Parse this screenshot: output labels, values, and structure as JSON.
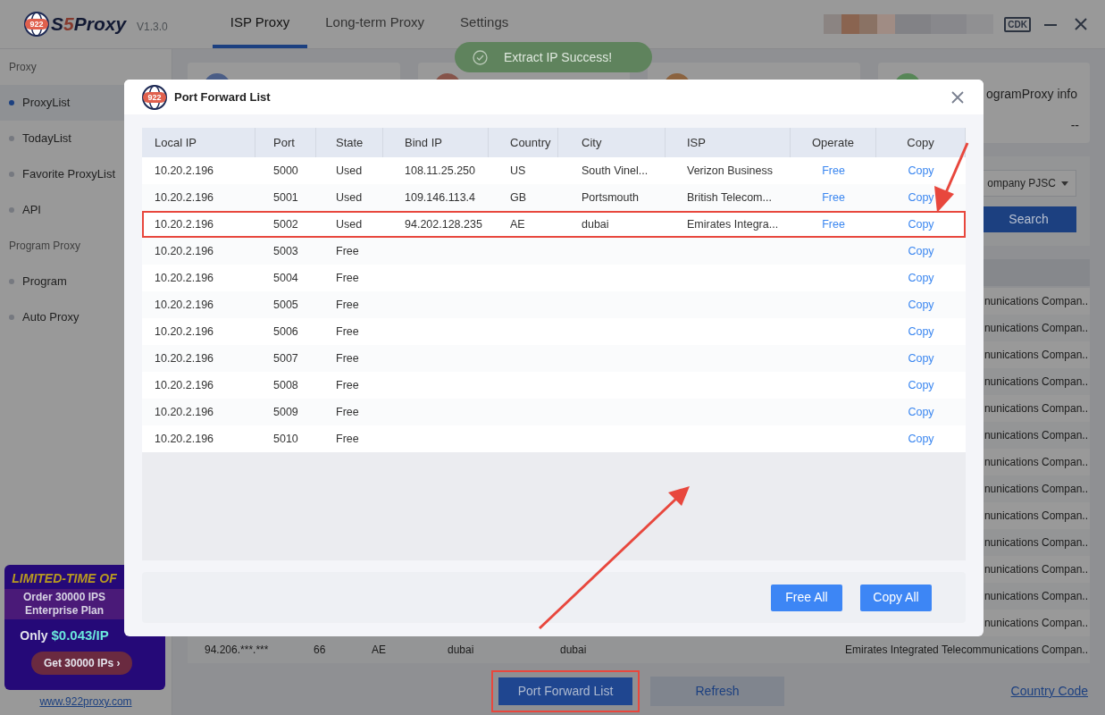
{
  "header": {
    "logo_badge": "922",
    "brand_prefix": "S",
    "brand_accent": "5",
    "brand_suffix": "Proxy",
    "version": "V1.3.0",
    "tabs": [
      {
        "label": "ISP Proxy",
        "selected": true
      },
      {
        "label": "Long-term Proxy",
        "selected": false
      },
      {
        "label": "Settings",
        "selected": false
      }
    ],
    "cdk_button": "CDK"
  },
  "toast": {
    "message": "Extract IP Success!"
  },
  "sidebar": {
    "sections": [
      {
        "title": "Proxy",
        "items": [
          {
            "label": "ProxyList",
            "selected": true
          },
          {
            "label": "TodayList",
            "selected": false
          },
          {
            "label": "Favorite ProxyList",
            "selected": false
          },
          {
            "label": "API",
            "selected": false
          }
        ]
      },
      {
        "title": "Program Proxy",
        "items": [
          {
            "label": "Program",
            "selected": false
          },
          {
            "label": "Auto Proxy",
            "selected": false
          }
        ]
      }
    ],
    "banner": {
      "headline": "LIMITED-TIME OF",
      "line_1": "Order 30000 IPS",
      "line_2": "Enterprise Plan",
      "only": "Only",
      "price": "$0.043/IP",
      "cta": "Get 30000 IPs ›"
    },
    "link": "www.922proxy.com"
  },
  "stat_cards": [
    {
      "color": "#4a5d86"
    },
    {
      "color": "#86544a"
    },
    {
      "color": "#8b633f"
    },
    {
      "color": "#568656",
      "title": "ogramProxy info",
      "value": "--"
    }
  ],
  "filter": {
    "select_value": "ompany PJSC",
    "search_button": "Search"
  },
  "proxy_rows": [
    {
      "isp": "nunications Compan.."
    },
    {
      "isp": "nunications Compan.."
    },
    {
      "isp": "nunications Compan.."
    },
    {
      "isp": "nunications Compan.."
    },
    {
      "isp": "nunications Compan.."
    },
    {
      "isp": "nunications Compan.."
    },
    {
      "isp": "nunications Compan.."
    },
    {
      "isp": "nunications Compan.."
    },
    {
      "isp": "nunications Compan.."
    },
    {
      "isp": "nunications Compan.."
    },
    {
      "isp": "nunications Compan.."
    },
    {
      "isp": "nunications Compan.."
    },
    {
      "isp": "nunications Compan.."
    },
    {
      "ip": "94.206.***.***",
      "port": "66",
      "country": "AE",
      "region": "dubai",
      "city": "dubai",
      "isp": "Emirates Integrated Telecommunications Compan.."
    }
  ],
  "bottom_bar": {
    "port_forward_button": "Port Forward List",
    "port_forward_annotated": true,
    "refresh_button": "Refresh",
    "country_code_link": "Country Code"
  },
  "modal": {
    "logo_badge": "922",
    "title": "Port Forward List",
    "columns": [
      "Local IP",
      "Port",
      "State",
      "Bind IP",
      "Country",
      "City",
      "ISP",
      "Operate",
      "Copy"
    ],
    "rows": [
      {
        "local_ip": "10.20.2.196",
        "port": "5000",
        "state": "Used",
        "bind_ip": "108.11.25.250",
        "country": "US",
        "city": "South Vinel...",
        "isp": "Verizon Business",
        "operate": "Free",
        "copy": "Copy",
        "highlighted": false
      },
      {
        "local_ip": "10.20.2.196",
        "port": "5001",
        "state": "Used",
        "bind_ip": "109.146.113.4",
        "country": "GB",
        "city": "Portsmouth",
        "isp": "British Telecom...",
        "operate": "Free",
        "copy": "Copy",
        "highlighted": false
      },
      {
        "local_ip": "10.20.2.196",
        "port": "5002",
        "state": "Used",
        "bind_ip": "94.202.128.235",
        "country": "AE",
        "city": "dubai",
        "isp": "Emirates Integra...",
        "operate": "Free",
        "copy": "Copy",
        "highlighted": true
      },
      {
        "local_ip": "10.20.2.196",
        "port": "5003",
        "state": "Free",
        "copy": "Copy",
        "highlighted": false
      },
      {
        "local_ip": "10.20.2.196",
        "port": "5004",
        "state": "Free",
        "copy": "Copy",
        "highlighted": false
      },
      {
        "local_ip": "10.20.2.196",
        "port": "5005",
        "state": "Free",
        "copy": "Copy",
        "highlighted": false
      },
      {
        "local_ip": "10.20.2.196",
        "port": "5006",
        "state": "Free",
        "copy": "Copy",
        "highlighted": false
      },
      {
        "local_ip": "10.20.2.196",
        "port": "5007",
        "state": "Free",
        "copy": "Copy",
        "highlighted": false
      },
      {
        "local_ip": "10.20.2.196",
        "port": "5008",
        "state": "Free",
        "copy": "Copy",
        "highlighted": false
      },
      {
        "local_ip": "10.20.2.196",
        "port": "5009",
        "state": "Free",
        "copy": "Copy",
        "highlighted": false
      },
      {
        "local_ip": "10.20.2.196",
        "port": "5010",
        "state": "Free",
        "copy": "Copy",
        "highlighted": false
      }
    ],
    "buttons": [
      "Free All",
      "Copy All"
    ]
  }
}
